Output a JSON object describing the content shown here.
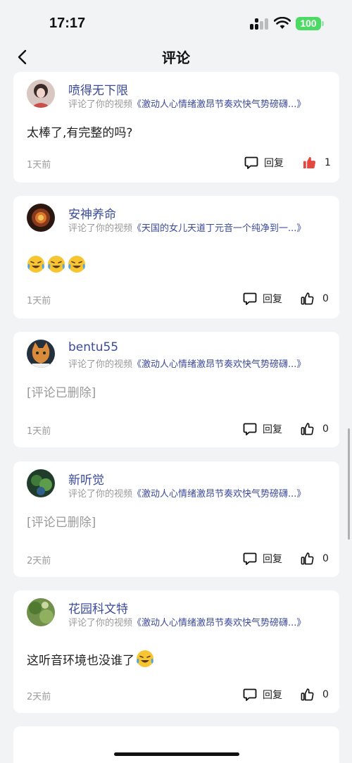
{
  "status_bar": {
    "time": "17:17",
    "battery": "100"
  },
  "nav": {
    "title": "评论"
  },
  "comments": [
    {
      "username": "喷得无下限",
      "action": "评论了你的视频",
      "video_title": "《激动人心情绪激昂节奏欢快气势磅礴...》",
      "text": "太棒了,有完整的吗?",
      "time": "1天前",
      "reply_label": "回复",
      "likes": "1",
      "liked": true
    },
    {
      "username": "安神养命",
      "action": "评论了你的视频",
      "video_title": "《天国的女儿天道丁元音一个纯净到一...》",
      "text": "",
      "emoji_count": 3,
      "time": "1天前",
      "reply_label": "回复",
      "likes": "0",
      "liked": false
    },
    {
      "username": "bentu55",
      "action": "评论了你的视频",
      "video_title": "《激动人心情绪激昂节奏欢快气势磅礴...》",
      "text": "[评论已删除]",
      "time": "1天前",
      "reply_label": "回复",
      "likes": "0",
      "liked": false
    },
    {
      "username": "新听觉",
      "action": "评论了你的视频",
      "video_title": "《激动人心情绪激昂节奏欢快气势磅礴...》",
      "text": "[评论已删除]",
      "time": "2天前",
      "reply_label": "回复",
      "likes": "0",
      "liked": false
    },
    {
      "username": "花园科文特",
      "action": "评论了你的视频",
      "video_title": "《激动人心情绪激昂节奏欢快气势磅礴...》",
      "text": "这听音环境也没谁了",
      "emoji_after_text": true,
      "time": "2天前",
      "reply_label": "回复",
      "likes": "0",
      "liked": false
    }
  ],
  "colors": {
    "link": "#3b4a9a",
    "like_active": "#e5483f",
    "background": "#f2f3f5"
  }
}
